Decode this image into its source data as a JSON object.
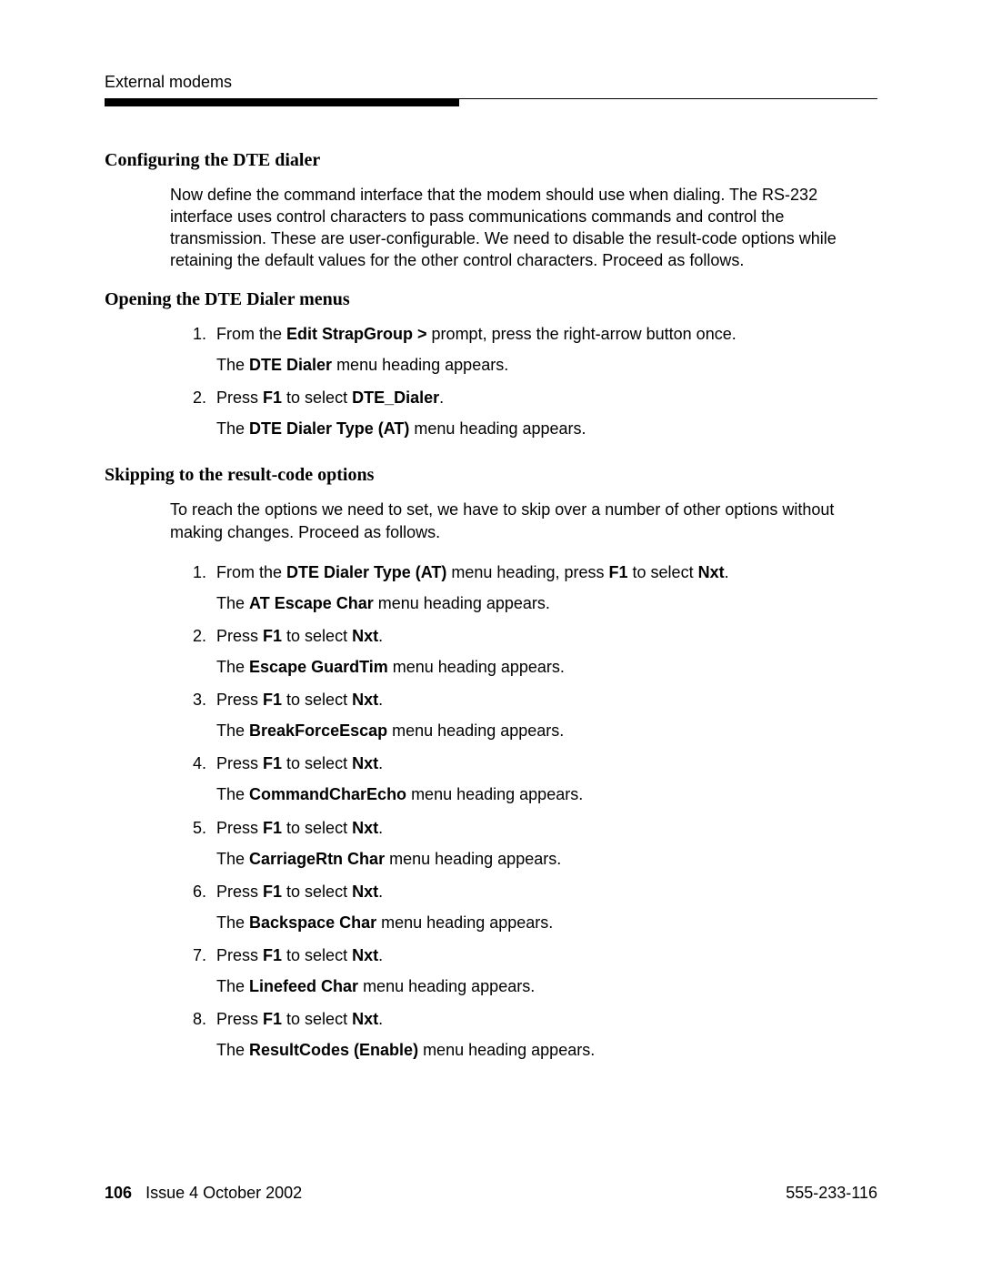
{
  "runningHead": "External modems",
  "sections": {
    "s1": {
      "title": "Configuring the DTE dialer",
      "para": "Now define the command interface that the modem should use when dialing. The RS-232 interface uses  control characters to pass communications commands and control the transmission. These are user-configurable. We need to disable the result-code options while retaining the default values for the other control characters. Proceed as follows."
    },
    "s2": {
      "title": "Opening the DTE Dialer menus",
      "steps": [
        {
          "pre1": "From the ",
          "b1": "Edit StrapGroup >",
          "post1": " prompt, press the right-arrow button once.",
          "after_pre": "The ",
          "after_b": "DTE Dialer",
          "after_post": " menu heading appears."
        },
        {
          "pre1": "Press ",
          "b1": "F1",
          "mid1": " to select ",
          "b2": "DTE_Dialer",
          "post1": ".",
          "after_pre": "The ",
          "after_b": "DTE Dialer Type (AT)",
          "after_post": " menu heading appears."
        }
      ]
    },
    "s3": {
      "title": "Skipping to the result-code options",
      "intro": "To reach the options we need to set, we have to skip over a number of other options without making changes. Proceed as follows.",
      "steps": [
        {
          "pre1": "From the ",
          "b1": "DTE Dialer Type (AT)",
          "mid1": " menu heading, press ",
          "b2": "F1",
          "mid2": " to select ",
          "b3": "Nxt",
          "post1": ".",
          "after_pre": "The ",
          "after_b": "AT Escape Char",
          "after_post": " menu heading appears."
        },
        {
          "pre1": "Press ",
          "b1": "F1",
          "mid1": " to select ",
          "b2": "Nxt",
          "post1": ".",
          "after_pre": "The ",
          "after_b": "Escape GuardTim",
          "after_post": " menu heading appears."
        },
        {
          "pre1": "Press ",
          "b1": "F1",
          "mid1": " to select ",
          "b2": "Nxt",
          "post1": ".",
          "after_pre": "The ",
          "after_b": "BreakForceEscap",
          "after_post": " menu heading appears."
        },
        {
          "pre1": "Press ",
          "b1": "F1",
          "mid1": " to select ",
          "b2": "Nxt",
          "post1": ".",
          "after_pre": "The ",
          "after_b": "CommandCharEcho",
          "after_post": " menu heading appears."
        },
        {
          "pre1": "Press ",
          "b1": "F1",
          "mid1": " to select ",
          "b2": "Nxt",
          "post1": ".",
          "after_pre": "The ",
          "after_b": "CarriageRtn Char",
          "after_post": " menu heading appears."
        },
        {
          "pre1": "Press ",
          "b1": "F1",
          "mid1": " to select ",
          "b2": "Nxt",
          "post1": ".",
          "after_pre": "The ",
          "after_b": "Backspace Char",
          "after_post": " menu heading appears."
        },
        {
          "pre1": "Press ",
          "b1": "F1",
          "mid1": " to select ",
          "b2": "Nxt",
          "post1": ".",
          "after_pre": "The ",
          "after_b": "Linefeed Char",
          "after_post": " menu heading appears."
        },
        {
          "pre1": "Press ",
          "b1": "F1",
          "mid1": " to select ",
          "b2": "Nxt",
          "post1": ".",
          "after_pre": "The ",
          "after_b": "ResultCodes (Enable)",
          "after_post": " menu heading appears."
        }
      ]
    }
  },
  "footer": {
    "pageNumber": "106",
    "issue": "Issue 4   October 2002",
    "docNumber": "555-233-116"
  }
}
